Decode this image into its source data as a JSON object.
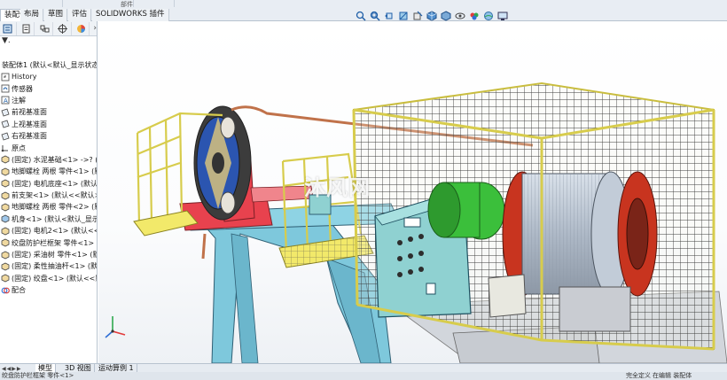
{
  "command_manager": {
    "tabs": [
      {
        "label": "装配体",
        "active": true
      },
      {
        "label": "布局",
        "active": false
      },
      {
        "label": "草图",
        "active": false
      },
      {
        "label": "评估",
        "active": false
      },
      {
        "label": "SOLIDWORKS 插件",
        "active": false
      }
    ],
    "top_label": "部件"
  },
  "heads_up_toolbar": {
    "icons": [
      "zoom-to-fit-icon",
      "zoom-to-area-icon",
      "previous-view-icon",
      "section-view-icon",
      "dynamic-annotation-icon",
      "view-orientation-icon",
      "display-style-icon",
      "hide-show-icon",
      "edit-appearance-icon",
      "apply-scene-icon",
      "view-settings-icon"
    ]
  },
  "feature_manager": {
    "tab_icons": [
      "feature-tree-icon",
      "property-manager-icon",
      "configuration-manager-icon",
      "dimxpert-icon",
      "display-manager-icon"
    ],
    "root_label": "装配体1 (默认<默认_显示状态-1",
    "items": [
      {
        "label": "History",
        "icon": "history-icon"
      },
      {
        "label": "传感器",
        "icon": "sensor-icon"
      },
      {
        "label": "注解",
        "icon": "annotation-icon"
      },
      {
        "label": "前视基准面",
        "icon": "plane-icon"
      },
      {
        "label": "上视基准面",
        "icon": "plane-icon"
      },
      {
        "label": "右视基准面",
        "icon": "plane-icon"
      },
      {
        "label": "原点",
        "icon": "origin-icon"
      },
      {
        "label": "(固定) 水泥基础<1> ->? (默认",
        "icon": "part-icon"
      },
      {
        "label": "地脚螺栓 两根 零件<1> (默",
        "icon": "part-icon"
      },
      {
        "label": "(固定) 电机底座<1> (默认<<默认>_显",
        "icon": "part-icon"
      },
      {
        "label": "前支架<1> (默认<<默认>_显",
        "icon": "part-icon"
      },
      {
        "label": "地脚螺栓 两根 零件<2> (默",
        "icon": "part-icon"
      },
      {
        "label": "机身<1> (默认<默认_显示状",
        "icon": "part-icon"
      },
      {
        "label": "(固定) 电机2<1> (默认<<默认",
        "icon": "part-icon"
      },
      {
        "label": "绞盘防护栏框架 零件<1> (默",
        "icon": "part-icon"
      },
      {
        "label": "(固定) 采油树 零件<1> (默认",
        "icon": "part-icon"
      },
      {
        "label": "(固定) 柔性抽油杆<1> (默认",
        "icon": "part-icon"
      },
      {
        "label": "(固定) 绞盘<1> (默认<<默认",
        "icon": "part-icon"
      },
      {
        "label": "配合",
        "icon": "mates-icon"
      }
    ]
  },
  "bottom_tabs": [
    {
      "label": "模型",
      "active": true
    },
    {
      "label": "3D 视图",
      "active": false
    },
    {
      "label": "运动算例 1",
      "active": false
    }
  ],
  "status_bar": {
    "left": "绞盘防护栏框架 零件<1>",
    "right1": "完全定义",
    "right2": "在编辑 装配体"
  },
  "viewport": {
    "watermark": "沐风网",
    "colors": {
      "frame_yellow": "#f2e96a",
      "steel_blue": "#7ec8dc",
      "red_part": "#e8424e",
      "cabinet": "#8fd1d1",
      "motor_green": "#3bbf3b",
      "drum_silver": "#b9c4d1"
    }
  }
}
